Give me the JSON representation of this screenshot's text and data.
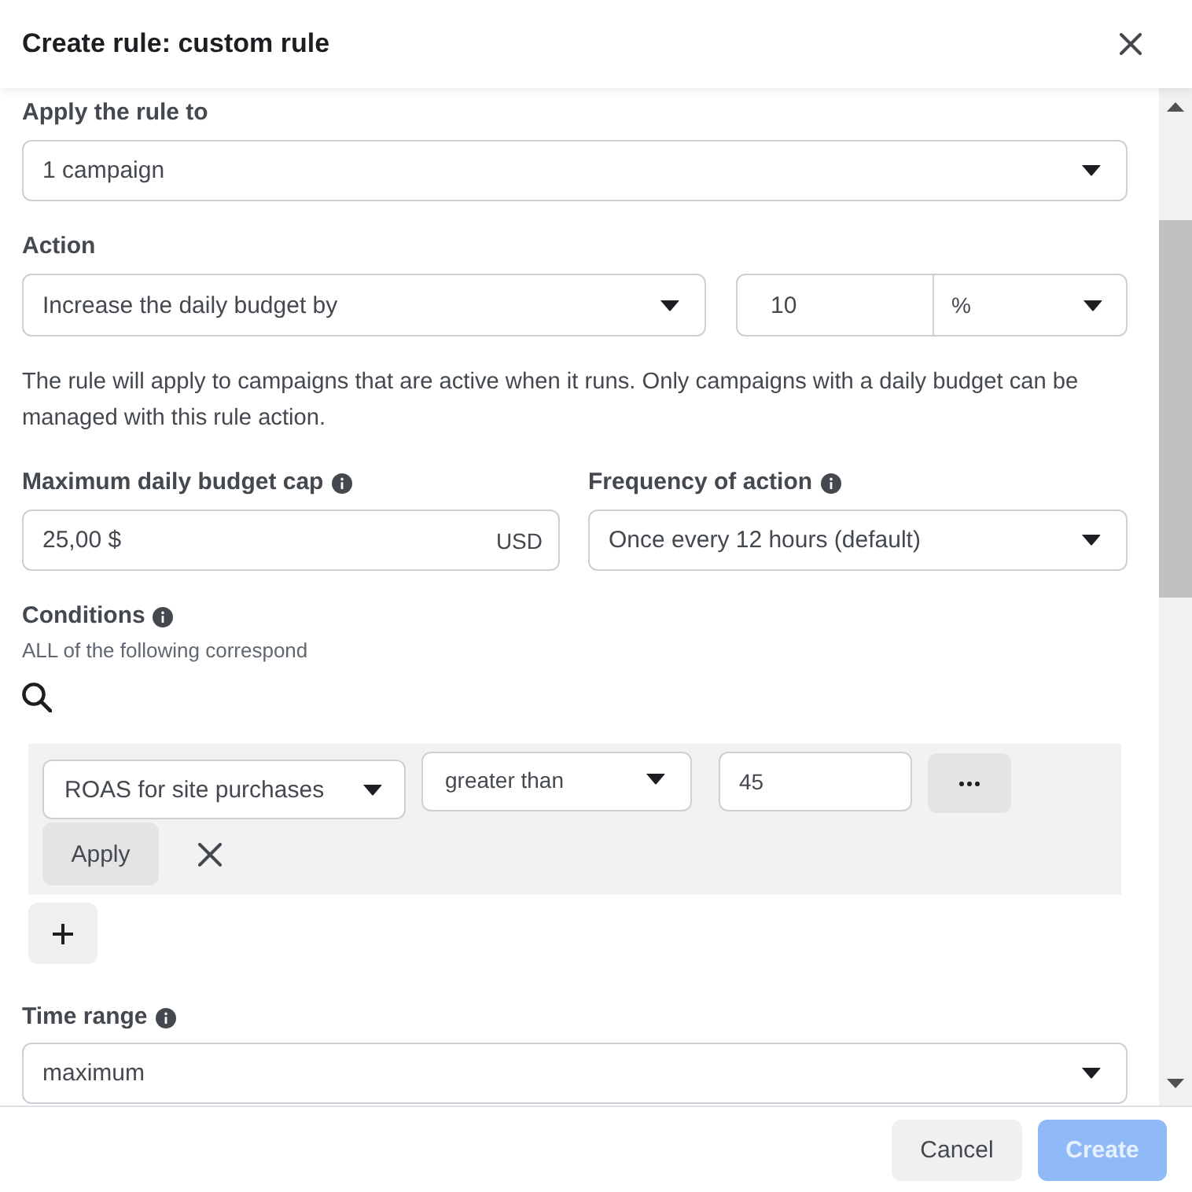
{
  "dialog": {
    "title": "Create rule: custom rule"
  },
  "apply_to": {
    "label": "Apply the rule to",
    "info": false,
    "value": "1 campaign"
  },
  "action": {
    "label": "Action",
    "info": false,
    "value": "Increase the daily budget by",
    "amount": "10",
    "unit": "%",
    "note": "The rule will apply to campaigns that are active when it runs. Only campaigns with a daily budget can be managed with this rule action."
  },
  "budget_cap": {
    "label": "Maximum daily budget cap",
    "info": true,
    "value": "25,00 $",
    "currency": "USD"
  },
  "frequency": {
    "label": "Frequency of action",
    "info": true,
    "value": "Once every 12 hours (default)"
  },
  "conditions": {
    "label": "Conditions",
    "info": true,
    "subtitle": "ALL of the following correspond",
    "items": [
      {
        "metric": "ROAS for site purchases",
        "operator": "greater than",
        "value": "45",
        "apply": "Apply"
      }
    ]
  },
  "time_range": {
    "label": "Time range",
    "info": true,
    "value": "maximum"
  },
  "footer": {
    "buttons": [
      {
        "label": "Cancel",
        "kind": "secondary",
        "disabled": false
      },
      {
        "label": "Create",
        "kind": "primary",
        "disabled": true
      }
    ]
  }
}
